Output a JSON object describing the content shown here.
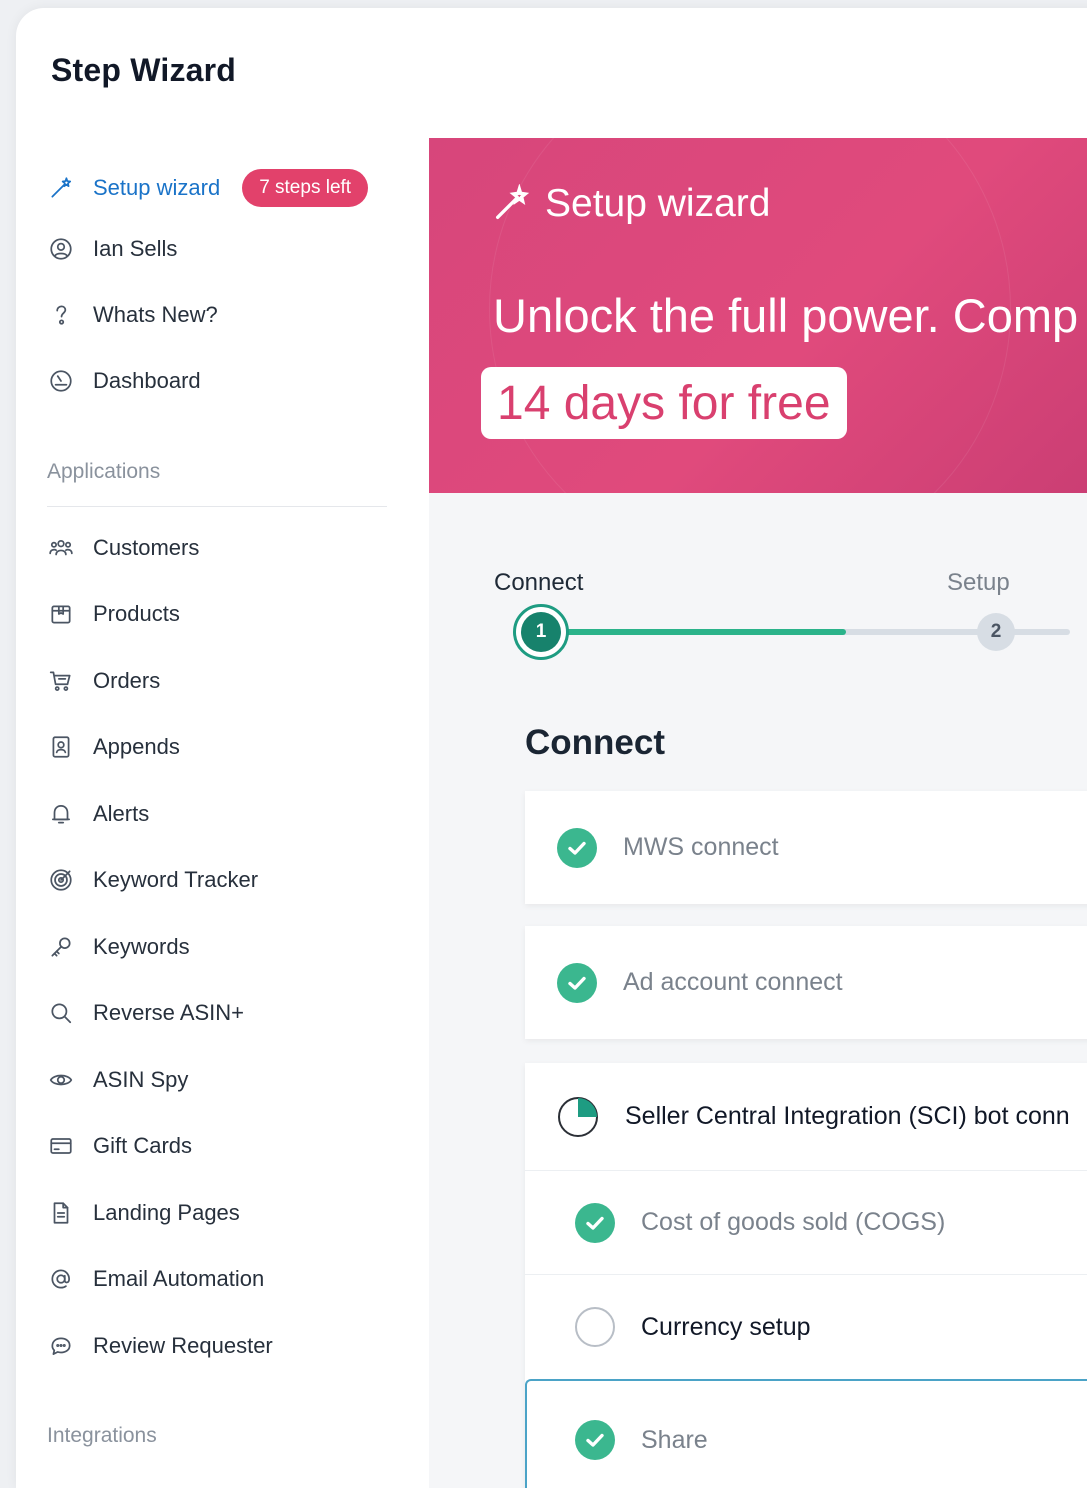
{
  "app": {
    "title": "Step Wizard"
  },
  "sidebar": {
    "primary": [
      {
        "label": "Setup wizard",
        "icon": "magic-wand-icon",
        "active": true
      },
      {
        "label": "Ian Sells",
        "icon": "user-circle-icon"
      },
      {
        "label": "Whats New?",
        "icon": "question-icon"
      },
      {
        "label": "Dashboard",
        "icon": "gauge-icon"
      }
    ],
    "badge": "7 steps left",
    "applications_label": "Applications",
    "applications": [
      {
        "label": "Customers",
        "icon": "users-icon"
      },
      {
        "label": "Products",
        "icon": "box-icon"
      },
      {
        "label": "Orders",
        "icon": "cart-icon"
      },
      {
        "label": "Appends",
        "icon": "contact-card-icon"
      },
      {
        "label": "Alerts",
        "icon": "bell-icon"
      },
      {
        "label": "Keyword Tracker",
        "icon": "target-icon"
      },
      {
        "label": "Keywords",
        "icon": "key-icon"
      },
      {
        "label": "Reverse ASIN+",
        "icon": "search-icon"
      },
      {
        "label": "ASIN Spy",
        "icon": "eye-icon"
      },
      {
        "label": "Gift Cards",
        "icon": "credit-card-icon"
      },
      {
        "label": "Landing Pages",
        "icon": "document-icon"
      },
      {
        "label": "Email Automation",
        "icon": "at-sign-icon"
      },
      {
        "label": "Review Requester",
        "icon": "chat-bubble-icon"
      }
    ],
    "integrations_label": "Integrations"
  },
  "hero": {
    "title": "Setup wizard",
    "headline": "Unlock the full power. Comp",
    "pill": "14 days for free",
    "colors": {
      "background": "#d9437a",
      "pill_text": "#d9406f"
    }
  },
  "stepper": {
    "steps": [
      {
        "label": "Connect",
        "number": "1",
        "state": "current"
      },
      {
        "label": "Setup",
        "number": "2",
        "state": "upcoming"
      }
    ],
    "progress_fraction_step1": 0.7,
    "colors": {
      "done": "#2bb38a",
      "pending": "#d7dde4"
    }
  },
  "connect": {
    "title": "Connect",
    "items": [
      {
        "label": "MWS connect",
        "status": "done"
      },
      {
        "label": "Ad account connect",
        "status": "done"
      },
      {
        "label": "Seller Central Integration (SCI) bot conn",
        "status": "partial"
      },
      {
        "label": "Cost of goods sold (COGS)",
        "status": "done"
      },
      {
        "label": "Currency setup",
        "status": "todo"
      },
      {
        "label": "Share",
        "status": "done"
      }
    ]
  }
}
